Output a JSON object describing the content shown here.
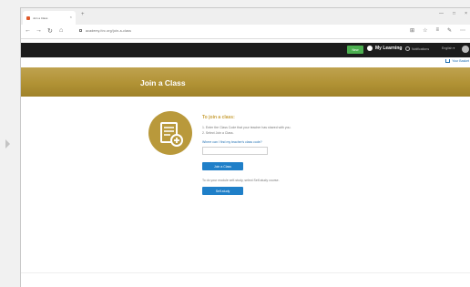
{
  "browser": {
    "tab_title": "Join a Class",
    "tab_close": "×",
    "new_tab": "+",
    "url": "academy.itrc.org/join-a-class",
    "window_controls": [
      "—",
      "□",
      "×"
    ],
    "nav": {
      "back": "←",
      "forward": "→",
      "reload": "↻",
      "home": "⌂"
    },
    "addr_icons": [
      "⊞",
      "☆",
      "≡",
      "✎",
      "⋯"
    ]
  },
  "site_nav": {
    "new_label": "New",
    "my_learning": "My Learning",
    "notifications": "Notifications",
    "language": "English ▾",
    "cart": "Your Basket"
  },
  "banner": {
    "title": "Join a Class"
  },
  "join": {
    "heading": "To join a class:",
    "steps": [
      "1. Enter the Class Code that your teacher has shared with you.",
      "2. Select Join a Class."
    ],
    "help_link": "Where can I find my teacher's class code?",
    "code_placeholder": "",
    "join_button": "Join a Class",
    "self_note": "To do your module self-study, select Self-study course.",
    "self_button": "Self-study"
  },
  "colors": {
    "gold": "#b9993b",
    "heading_gold": "#c9a13c",
    "button_blue": "#1f7fc8",
    "nav_dark": "#1c1c1c",
    "new_green": "#4caf50"
  }
}
